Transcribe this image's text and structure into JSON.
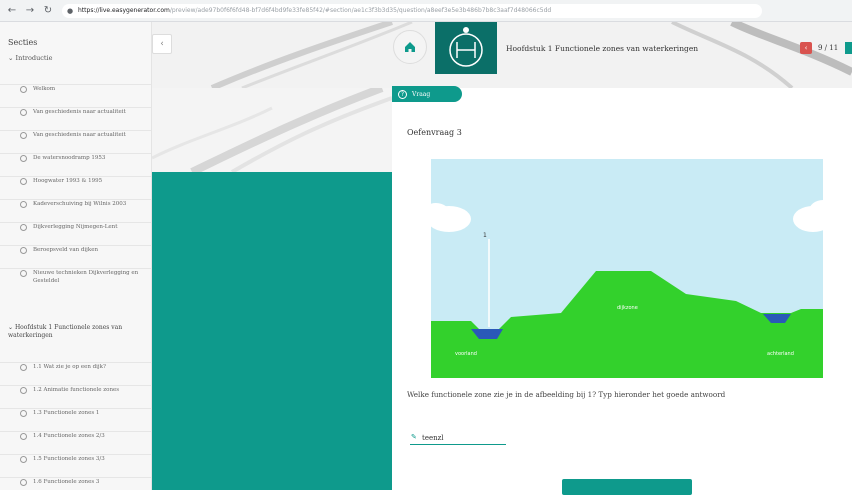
{
  "browser": {
    "url_host": "https://live.easygenerator.com",
    "url_path": "/preview/ade97b0f6f6fd48-bf7d6f4bd9fe33fe85f42/#section/ae1c3f3b3d35/question/a8eef3e5e3b486b7b8c3aaf7d48066c5dd"
  },
  "sidebar": {
    "title": "Secties",
    "intro_label": "Introductie",
    "items": [
      {
        "label": "Welkom"
      },
      {
        "label": "Van geschiedenis naar actualiteit"
      },
      {
        "label": "Van geschiedenis naar actualiteit"
      },
      {
        "label": "De watersnoodramp 1953"
      },
      {
        "label": "Hoogwater 1993 & 1995"
      },
      {
        "label": "Kadeverschuiving bij Wilnis 2003"
      },
      {
        "label": "Dijkverlegging Nijmegen-Lent"
      },
      {
        "label": "Beroepsveld van dijken"
      },
      {
        "label": "Nieuwe technieken Dijkverlegging en Gesteldel"
      }
    ],
    "chapter_label": "Hoofdstuk 1 Functionele zones van waterkeringen",
    "chapter_items": [
      {
        "label": "1.1 Wat zie je op een dijk?"
      },
      {
        "label": "1.2 Animatie functionele zones"
      },
      {
        "label": "1.3 Functionele zones 1"
      },
      {
        "label": "1.4 Functionele zones 2/3"
      },
      {
        "label": "1.5 Functionele zones 3/3"
      },
      {
        "label": "1.6 Functionele zones 3"
      }
    ]
  },
  "header": {
    "chapter_title": "Hoofdstuk 1 Functionele zones van waterkeringen",
    "pager": "9 / 11"
  },
  "question": {
    "tag_label": "Vraag",
    "title": "Oefenvraag 3",
    "prompt": "Welke functionele zone zie je in de afbeelding bij 1? Typ hieronder het goede antwoord",
    "answer_value": "teenzl"
  },
  "figure": {
    "marker_label": "1",
    "labels": {
      "dike": "dijkzone",
      "foreland": "voorland",
      "backland": "achterland"
    },
    "colors": {
      "sky": "#c9ebf5",
      "grass": "#33d12c",
      "water": "#2a59b8",
      "accent": "#0e9a8c"
    }
  }
}
